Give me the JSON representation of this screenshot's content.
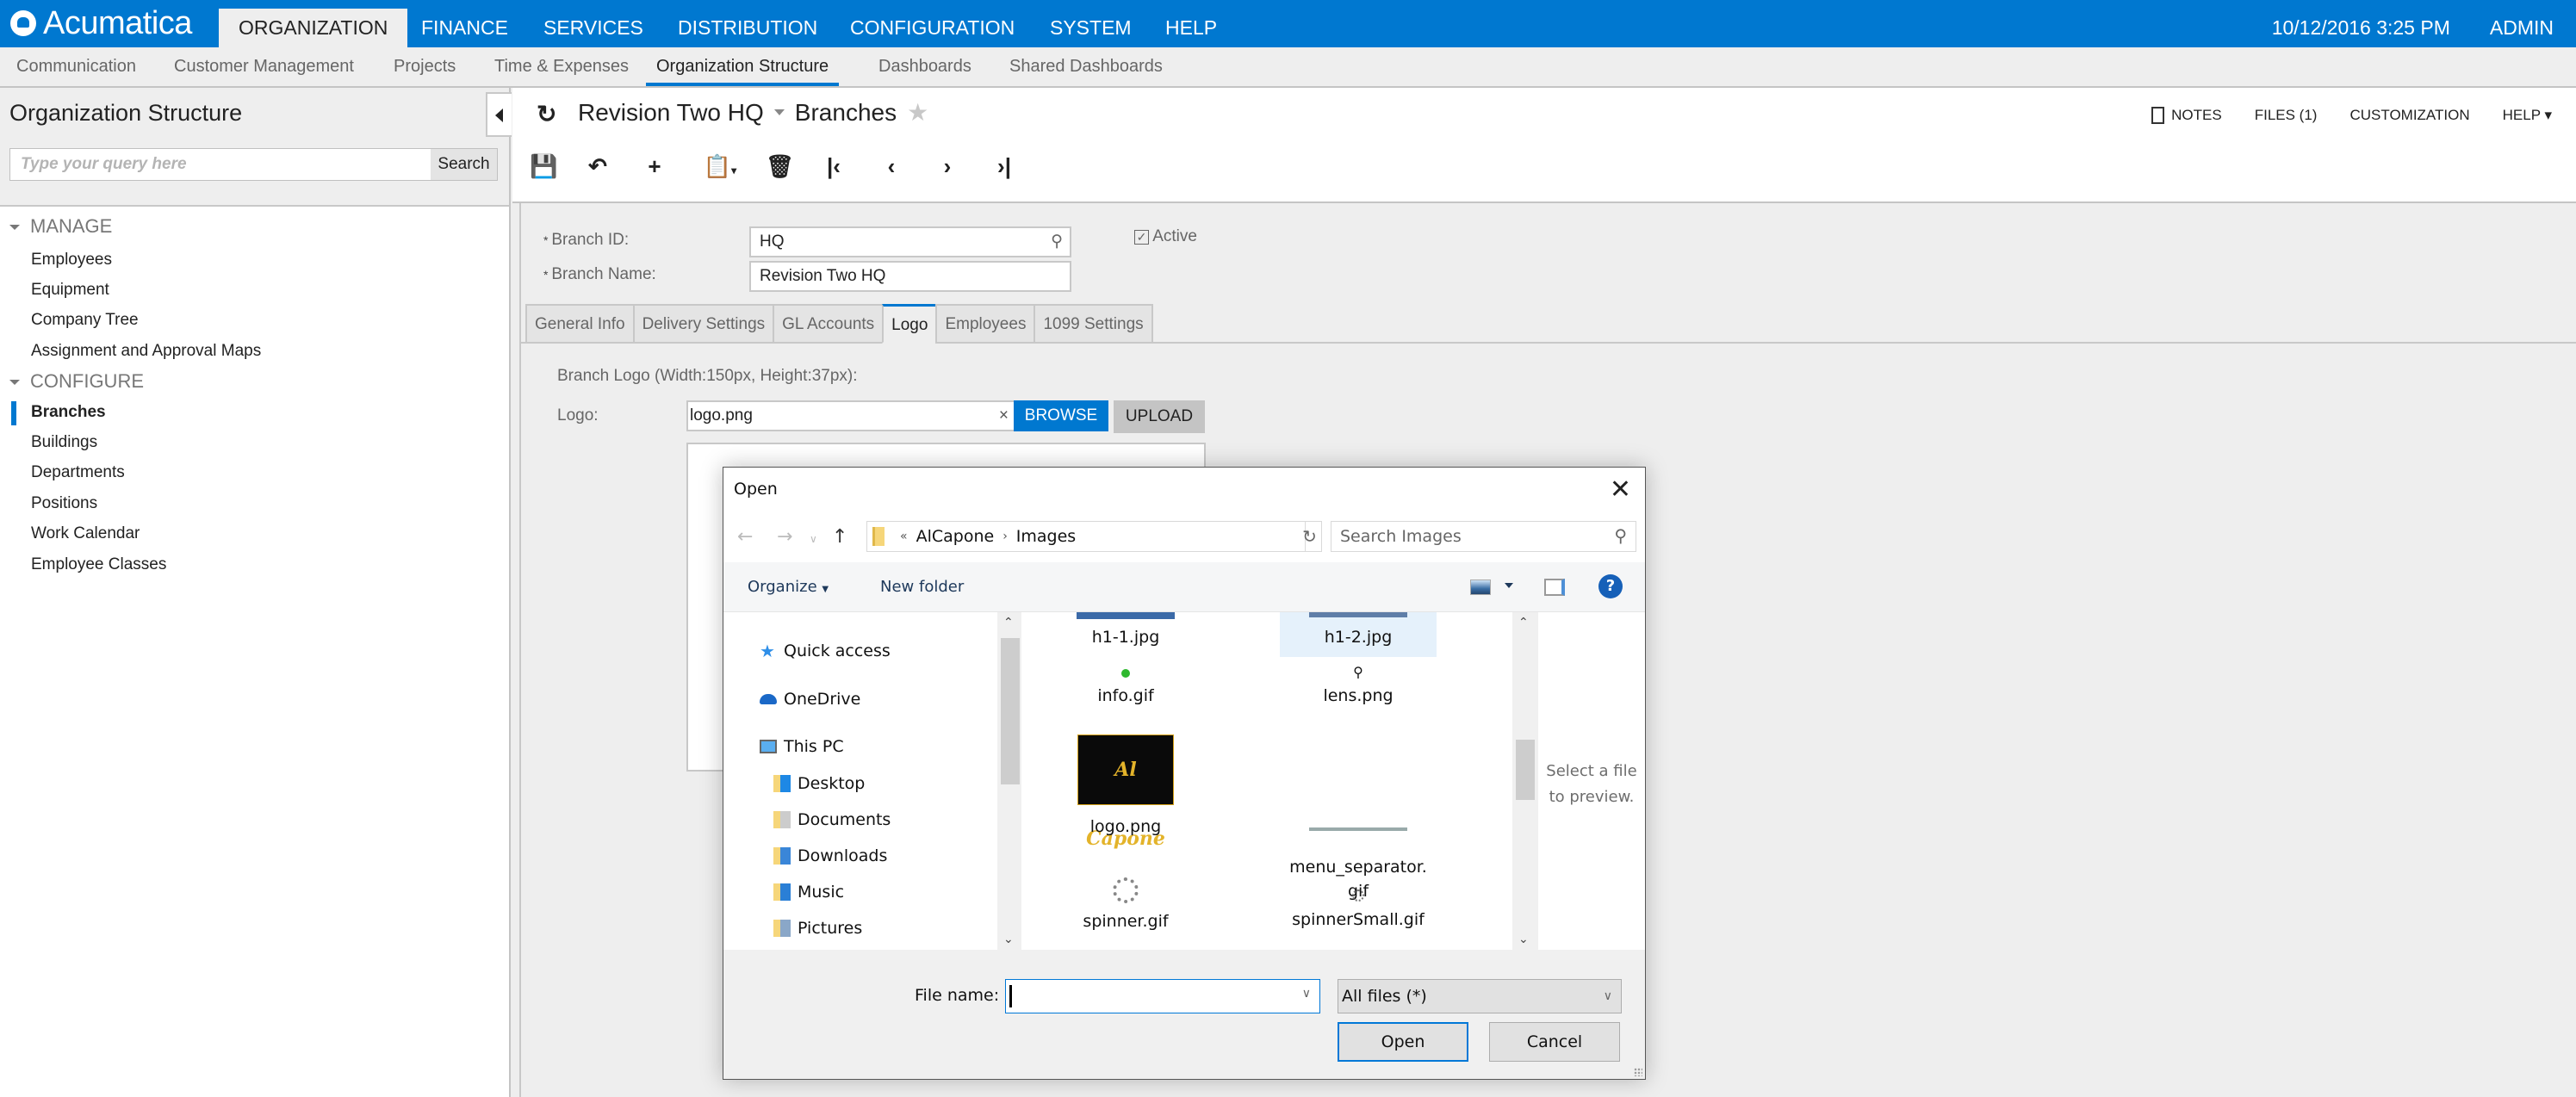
{
  "app": {
    "brand": "Acumatica",
    "datetime": "10/12/2016  3:25 PM",
    "user": "ADMIN"
  },
  "top_nav": [
    {
      "label": "ORGANIZATION",
      "active": true
    },
    {
      "label": "FINANCE"
    },
    {
      "label": "SERVICES"
    },
    {
      "label": "DISTRIBUTION"
    },
    {
      "label": "CONFIGURATION"
    },
    {
      "label": "SYSTEM"
    },
    {
      "label": "HELP"
    }
  ],
  "sub_nav": [
    {
      "label": "Communication"
    },
    {
      "label": "Customer Management"
    },
    {
      "label": "Projects"
    },
    {
      "label": "Time & Expenses"
    },
    {
      "label": "Organization Structure",
      "active": true
    },
    {
      "label": "Dashboards"
    },
    {
      "label": "Shared Dashboards"
    }
  ],
  "sidebar": {
    "title": "Organization Structure",
    "search_placeholder": "Type your query here",
    "search_button": "Search",
    "groups": [
      {
        "label": "MANAGE",
        "items": [
          "Employees",
          "Equipment",
          "Company Tree",
          "Assignment and Approval Maps"
        ]
      },
      {
        "label": "CONFIGURE",
        "items": [
          "Branches",
          "Buildings",
          "Departments",
          "Positions",
          "Work Calendar",
          "Employee Classes"
        ]
      }
    ],
    "active_item": "Branches"
  },
  "page": {
    "record": "Revision Two HQ",
    "screen": "Branches",
    "actions": {
      "notes": "NOTES",
      "files": "FILES (1)",
      "customization": "CUSTOMIZATION",
      "help": "HELP"
    },
    "toolbar": [
      "save-icon",
      "undo-icon",
      "add-icon",
      "copy-paste-icon",
      "delete-icon",
      "first-icon",
      "previous-icon",
      "next-icon",
      "last-icon"
    ]
  },
  "form": {
    "branch_id_label": "Branch ID:",
    "branch_id": "HQ",
    "branch_name_label": "Branch Name:",
    "branch_name": "Revision Two HQ",
    "active_label": "Active",
    "active_checked": true,
    "tabs": [
      "General Info",
      "Delivery Settings",
      "GL Accounts",
      "Logo",
      "Employees",
      "1099 Settings"
    ],
    "active_tab": "Logo",
    "logo_caption": "Branch Logo (Width:150px, Height:37px):",
    "logo_label": "Logo:",
    "logo_file": "logo.png",
    "browse": "BROWSE",
    "upload": "UPLOAD",
    "clear": "×"
  },
  "dialog": {
    "title": "Open",
    "close": "✕",
    "path": [
      "«",
      "AlCapone",
      "Images"
    ],
    "search_placeholder": "Search Images",
    "organize": "Organize",
    "new_folder": "New folder",
    "nav_tree": [
      {
        "label": "Quick access",
        "icon": "quick-access-icon"
      },
      {
        "label": "OneDrive",
        "icon": "onedrive-icon"
      },
      {
        "label": "This PC",
        "icon": "this-pc-icon"
      },
      {
        "label": "Desktop",
        "icon": "desktop-folder-icon"
      },
      {
        "label": "Documents",
        "icon": "documents-folder-icon"
      },
      {
        "label": "Downloads",
        "icon": "downloads-folder-icon"
      },
      {
        "label": "Music",
        "icon": "music-folder-icon"
      },
      {
        "label": "Pictures",
        "icon": "pictures-folder-icon"
      }
    ],
    "files": [
      {
        "name": "h1-1.jpg"
      },
      {
        "name": "h1-2.jpg",
        "selected": true
      },
      {
        "name": "info.gif"
      },
      {
        "name": "lens.png"
      },
      {
        "name": "logo.png"
      },
      {
        "name": "menu_separator.\ngif"
      },
      {
        "name": "spinner.gif"
      },
      {
        "name": "spinnerSmall.gif"
      }
    ],
    "logo_thumb_text": "Al Capone",
    "preview_text": "Select a file to preview.",
    "file_name_label": "File name:",
    "file_name_value": "",
    "file_type": "All files (*)",
    "open_button": "Open",
    "cancel_button": "Cancel"
  }
}
